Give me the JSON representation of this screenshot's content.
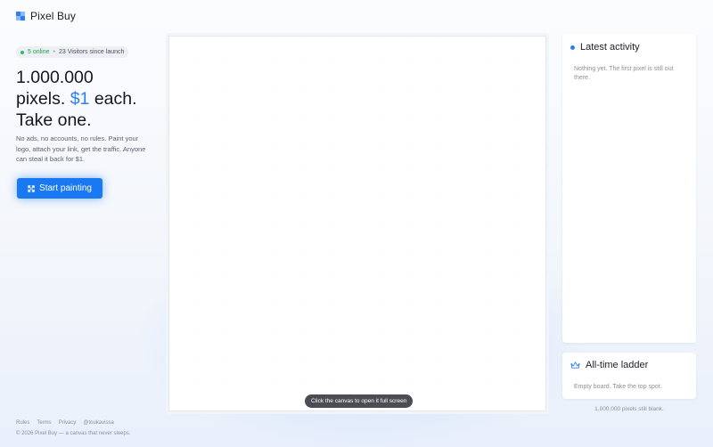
{
  "brand": {
    "name": "Pixel Buy",
    "icon": "pixel-grid-icon",
    "colors": [
      "#2f7df6",
      "#8fb8fb",
      "#2f7df6"
    ]
  },
  "status": {
    "online": "5 online",
    "separator": "•",
    "visitors": "23 Visitors since launch"
  },
  "hero": {
    "line1": "1.000.000",
    "line2_pre": "pixels.",
    "line2_price": "$1",
    "line2_post": "each.",
    "line3": "Take one.",
    "description": "No ads, no accounts, no rules. Paint your logo, attach your link, get the traffic. Anyone can steal it back for $1.",
    "cta_label": "Start painting",
    "cta_icon": "expand-arrows-icon"
  },
  "canvas": {
    "tip": "Click the canvas to open it full screen"
  },
  "activity": {
    "title": "Latest activity",
    "empty": "Nothing yet. The first pixel is still out there."
  },
  "ladder": {
    "title": "All-time ladder",
    "icon": "crown-icon",
    "empty": "Empty board. Take the top spot."
  },
  "pixels_blank": "1.000.000 pixels still blank.",
  "footer": {
    "links": [
      "Rules",
      "Terms",
      "Privacy",
      "@toukavissa"
    ],
    "copyright": "© 2026 Pixel Buy — a canvas that never sleeps."
  },
  "colors": {
    "accent": "#2f7df6",
    "cta": "#1a78f2",
    "online": "#22c55e"
  }
}
